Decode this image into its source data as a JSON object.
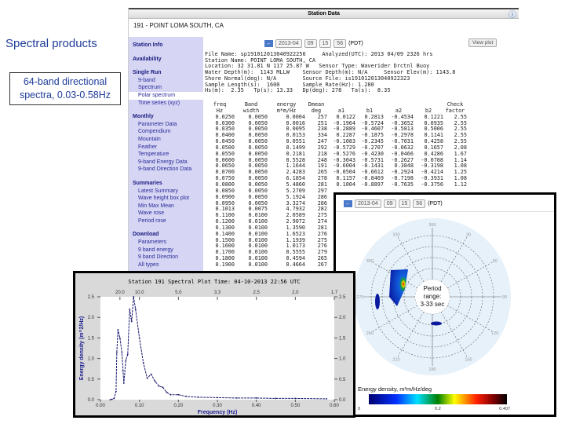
{
  "slide": {
    "title": "Spectral products",
    "description": "64-band directional spectra, 0.03-0.58Hz"
  },
  "station_window": {
    "title": "Station Data",
    "station": "191 - POINT LOMA SOUTH, CA",
    "icons": [
      "map-icon",
      "info-icon"
    ]
  },
  "sidebar": [
    {
      "type": "h",
      "label": "Station Info"
    },
    {
      "type": "gap"
    },
    {
      "type": "h",
      "label": "Availability"
    },
    {
      "type": "gap"
    },
    {
      "type": "h",
      "label": "Single Run"
    },
    {
      "type": "i",
      "label": "9-band"
    },
    {
      "type": "i",
      "label": "Spectrum"
    },
    {
      "type": "i",
      "label": "Polar spectrum",
      "selected": true
    },
    {
      "type": "i",
      "label": "Time series (xyz)"
    },
    {
      "type": "gap"
    },
    {
      "type": "h",
      "label": "Monthly"
    },
    {
      "type": "i",
      "label": "Parameter Data"
    },
    {
      "type": "i",
      "label": "Compendium"
    },
    {
      "type": "i",
      "label": "Mountain"
    },
    {
      "type": "i",
      "label": "Feather"
    },
    {
      "type": "i",
      "label": "Temperature"
    },
    {
      "type": "i",
      "label": "9-band Energy Data"
    },
    {
      "type": "i",
      "label": "9-band Direction Data"
    },
    {
      "type": "gap"
    },
    {
      "type": "h",
      "label": "Summaries"
    },
    {
      "type": "i",
      "label": "Latest Summary"
    },
    {
      "type": "i",
      "label": "Wave height box plot"
    },
    {
      "type": "i",
      "label": "Min Max Mean"
    },
    {
      "type": "i",
      "label": "Wave rose"
    },
    {
      "type": "i",
      "label": "Period rose"
    },
    {
      "type": "gap"
    },
    {
      "type": "h",
      "label": "Download"
    },
    {
      "type": "i",
      "label": "Parameters"
    },
    {
      "type": "i",
      "label": "9 band energy"
    },
    {
      "type": "i",
      "label": "9 band Direction"
    },
    {
      "type": "i",
      "label": "All types"
    }
  ],
  "controls": {
    "date": "2013-04",
    "hour": "09",
    "minute": "15",
    "second": "56",
    "tz": "(PDT)",
    "view_plot": "View plot"
  },
  "header_text": "File Name: sp191012013040922256     Analyzed(UTC): 2013 04/09 2326 hrs\nStation Name: POINT LOMA SOUTH, CA\nLocation: 32 31.81 N 117 25.87 W   Sensor Type: Waverider Drctnl Buoy\nWater Depth(m):  1143 MLLW    Sensor Depth(m): N/A     Sensor Elev(m): 1143.8\nShore Normal(deg): N/A        Source File: is191012013040922323\nSample Length(s):  1600       Sample Rate(Hz): 1.280\nHs(m):  2.35   Tp(s): 13.33   Dp(deg): 278   Ta(s):  8.35",
  "table": {
    "headers": [
      [
        "freq",
        "Hz"
      ],
      [
        "Band",
        "width"
      ],
      [
        "energy",
        "m*m/Hz"
      ],
      [
        "Dmean",
        "deg"
      ],
      [
        "a1",
        ""
      ],
      [
        "b1",
        ""
      ],
      [
        "a2",
        ""
      ],
      [
        "b2",
        ""
      ],
      [
        "Check",
        "factor"
      ]
    ],
    "rows": [
      [
        "0.0250",
        "0.0050",
        "0.0004",
        "257",
        "0.0122",
        "0.2813",
        "-0.4534",
        "0.1221",
        "2.55"
      ],
      [
        "0.0300",
        "0.0050",
        "0.0016",
        "251",
        "-0.1964",
        "-0.5724",
        "-0.3652",
        "0.0935",
        "2.55"
      ],
      [
        "0.0350",
        "0.0050",
        "0.0095",
        "238",
        "-0.2889",
        "-0.4607",
        "-0.5813",
        "0.5006",
        "2.55"
      ],
      [
        "0.0400",
        "0.0050",
        "0.0153",
        "334",
        "0.2287",
        "-0.1875",
        "-0.2978",
        "0.1141",
        "2.55"
      ],
      [
        "0.0450",
        "0.0050",
        "0.0551",
        "247",
        "-0.1083",
        "-0.2345",
        "-0.7031",
        "0.4258",
        "2.55"
      ],
      [
        "0.0500",
        "0.0050",
        "0.1499",
        "292",
        "-0.5729",
        "-0.2707",
        "-0.0632",
        "0.1657",
        "2.08"
      ],
      [
        "0.0550",
        "0.0050",
        "0.2181",
        "218",
        "-0.5276",
        "-0.4230",
        "-0.0466",
        "0.4286",
        "1.67"
      ],
      [
        "0.0600",
        "0.0050",
        "0.5528",
        "248",
        "-0.3043",
        "-0.5731",
        "-0.2627",
        "-0.0788",
        "1.14"
      ],
      [
        "0.0650",
        "0.0050",
        "1.1644",
        "191",
        "-0.6004",
        "-0.1431",
        "0.3848",
        "-0.3198",
        "1.08"
      ],
      [
        "0.0700",
        "0.0050",
        "2.4283",
        "265",
        "-0.0504",
        "-0.6612",
        "-0.2924",
        "-0.4214",
        "1.25"
      ],
      [
        "0.0750",
        "0.0050",
        "6.1854",
        "278",
        "0.1157",
        "-0.8469",
        "-0.7198",
        "-0.3931",
        "1.08"
      ],
      [
        "0.0800",
        "0.0050",
        "5.4860",
        "281",
        "0.1004",
        "-0.8897",
        "-0.7635",
        "-0.3756",
        "1.12"
      ],
      [
        "0.0850",
        "0.0050",
        "5.2709",
        "297"
      ],
      [
        "0.0900",
        "0.0050",
        "5.1924",
        "286"
      ],
      [
        "0.0950",
        "0.0050",
        "3.3274",
        "286"
      ],
      [
        "0.1013",
        "0.0075",
        "4.7932",
        "282"
      ],
      [
        "0.1100",
        "0.0100",
        "2.0589",
        "275"
      ],
      [
        "0.1200",
        "0.0100",
        "2.9072",
        "274"
      ],
      [
        "0.1300",
        "0.0100",
        "1.3590",
        "281"
      ],
      [
        "0.1400",
        "0.0100",
        "1.6523",
        "276"
      ],
      [
        "0.1500",
        "0.0100",
        "1.1939",
        "275"
      ],
      [
        "0.1600",
        "0.0100",
        "1.0173",
        "276"
      ],
      [
        "0.1700",
        "0.0100",
        "0.5555",
        "279"
      ],
      [
        "0.1800",
        "0.0100",
        "0.4594",
        "265"
      ],
      [
        "0.1900",
        "0.0100",
        "0.4664",
        "267"
      ]
    ]
  },
  "chart_data": [
    {
      "type": "line",
      "title": "Station 191 Spectral Plot     Time: 04-10-2013 22:56 UTC",
      "xlabel": "Frequency (Hz)",
      "ylabel": "Energy density (m^2/Hz)",
      "xlim": [
        0,
        0.6
      ],
      "ylim": [
        0,
        2.5
      ],
      "x_ticks": [
        "0.00",
        "0.10",
        "0.20",
        "0.30",
        "0.40",
        "0.50",
        "0.60"
      ],
      "y_ticks": [
        "0.0",
        "0.5",
        "1.0",
        "1.5",
        "2.0",
        "2.5"
      ],
      "top_ticks": [
        "20.0",
        "10.0",
        "5.0",
        "3.3",
        "2.5",
        "2.0",
        "1.7"
      ],
      "x": [
        0.025,
        0.03,
        0.035,
        0.04,
        0.042,
        0.045,
        0.05,
        0.055,
        0.058,
        0.06,
        0.065,
        0.07,
        0.075,
        0.08,
        0.085,
        0.09,
        0.1,
        0.11,
        0.12,
        0.13,
        0.14,
        0.15,
        0.16,
        0.17,
        0.18,
        0.2,
        0.22,
        0.25,
        0.3,
        0.35,
        0.4,
        0.45,
        0.5,
        0.58
      ],
      "y": [
        0,
        0.01,
        0.03,
        0.2,
        1.15,
        1.7,
        1.5,
        1.15,
        0.7,
        0.4,
        0.95,
        1.1,
        2.2,
        1.9,
        2.5,
        2.2,
        1.5,
        0.9,
        0.52,
        0.62,
        0.45,
        0.33,
        0.3,
        0.18,
        0.12,
        0.12,
        0.08,
        0.06,
        0.05,
        0.04,
        0.04,
        0.03,
        0.03,
        0.02
      ],
      "color": "#1a1a6e"
    },
    {
      "type": "heatmap",
      "title": "Polar spectrum",
      "center_label": [
        "Period",
        "range:",
        "3-33 sec"
      ],
      "direction_labels": [
        "360",
        "30",
        "60",
        "90",
        "120",
        "150",
        "180",
        "210",
        "240",
        "270",
        "300",
        "330"
      ],
      "colorbar_label": "Energy density, m²m/Hz/deg",
      "colorbar_ticks": [
        "0",
        "0.2",
        "0.407"
      ],
      "peak_direction_deg": 290
    }
  ]
}
